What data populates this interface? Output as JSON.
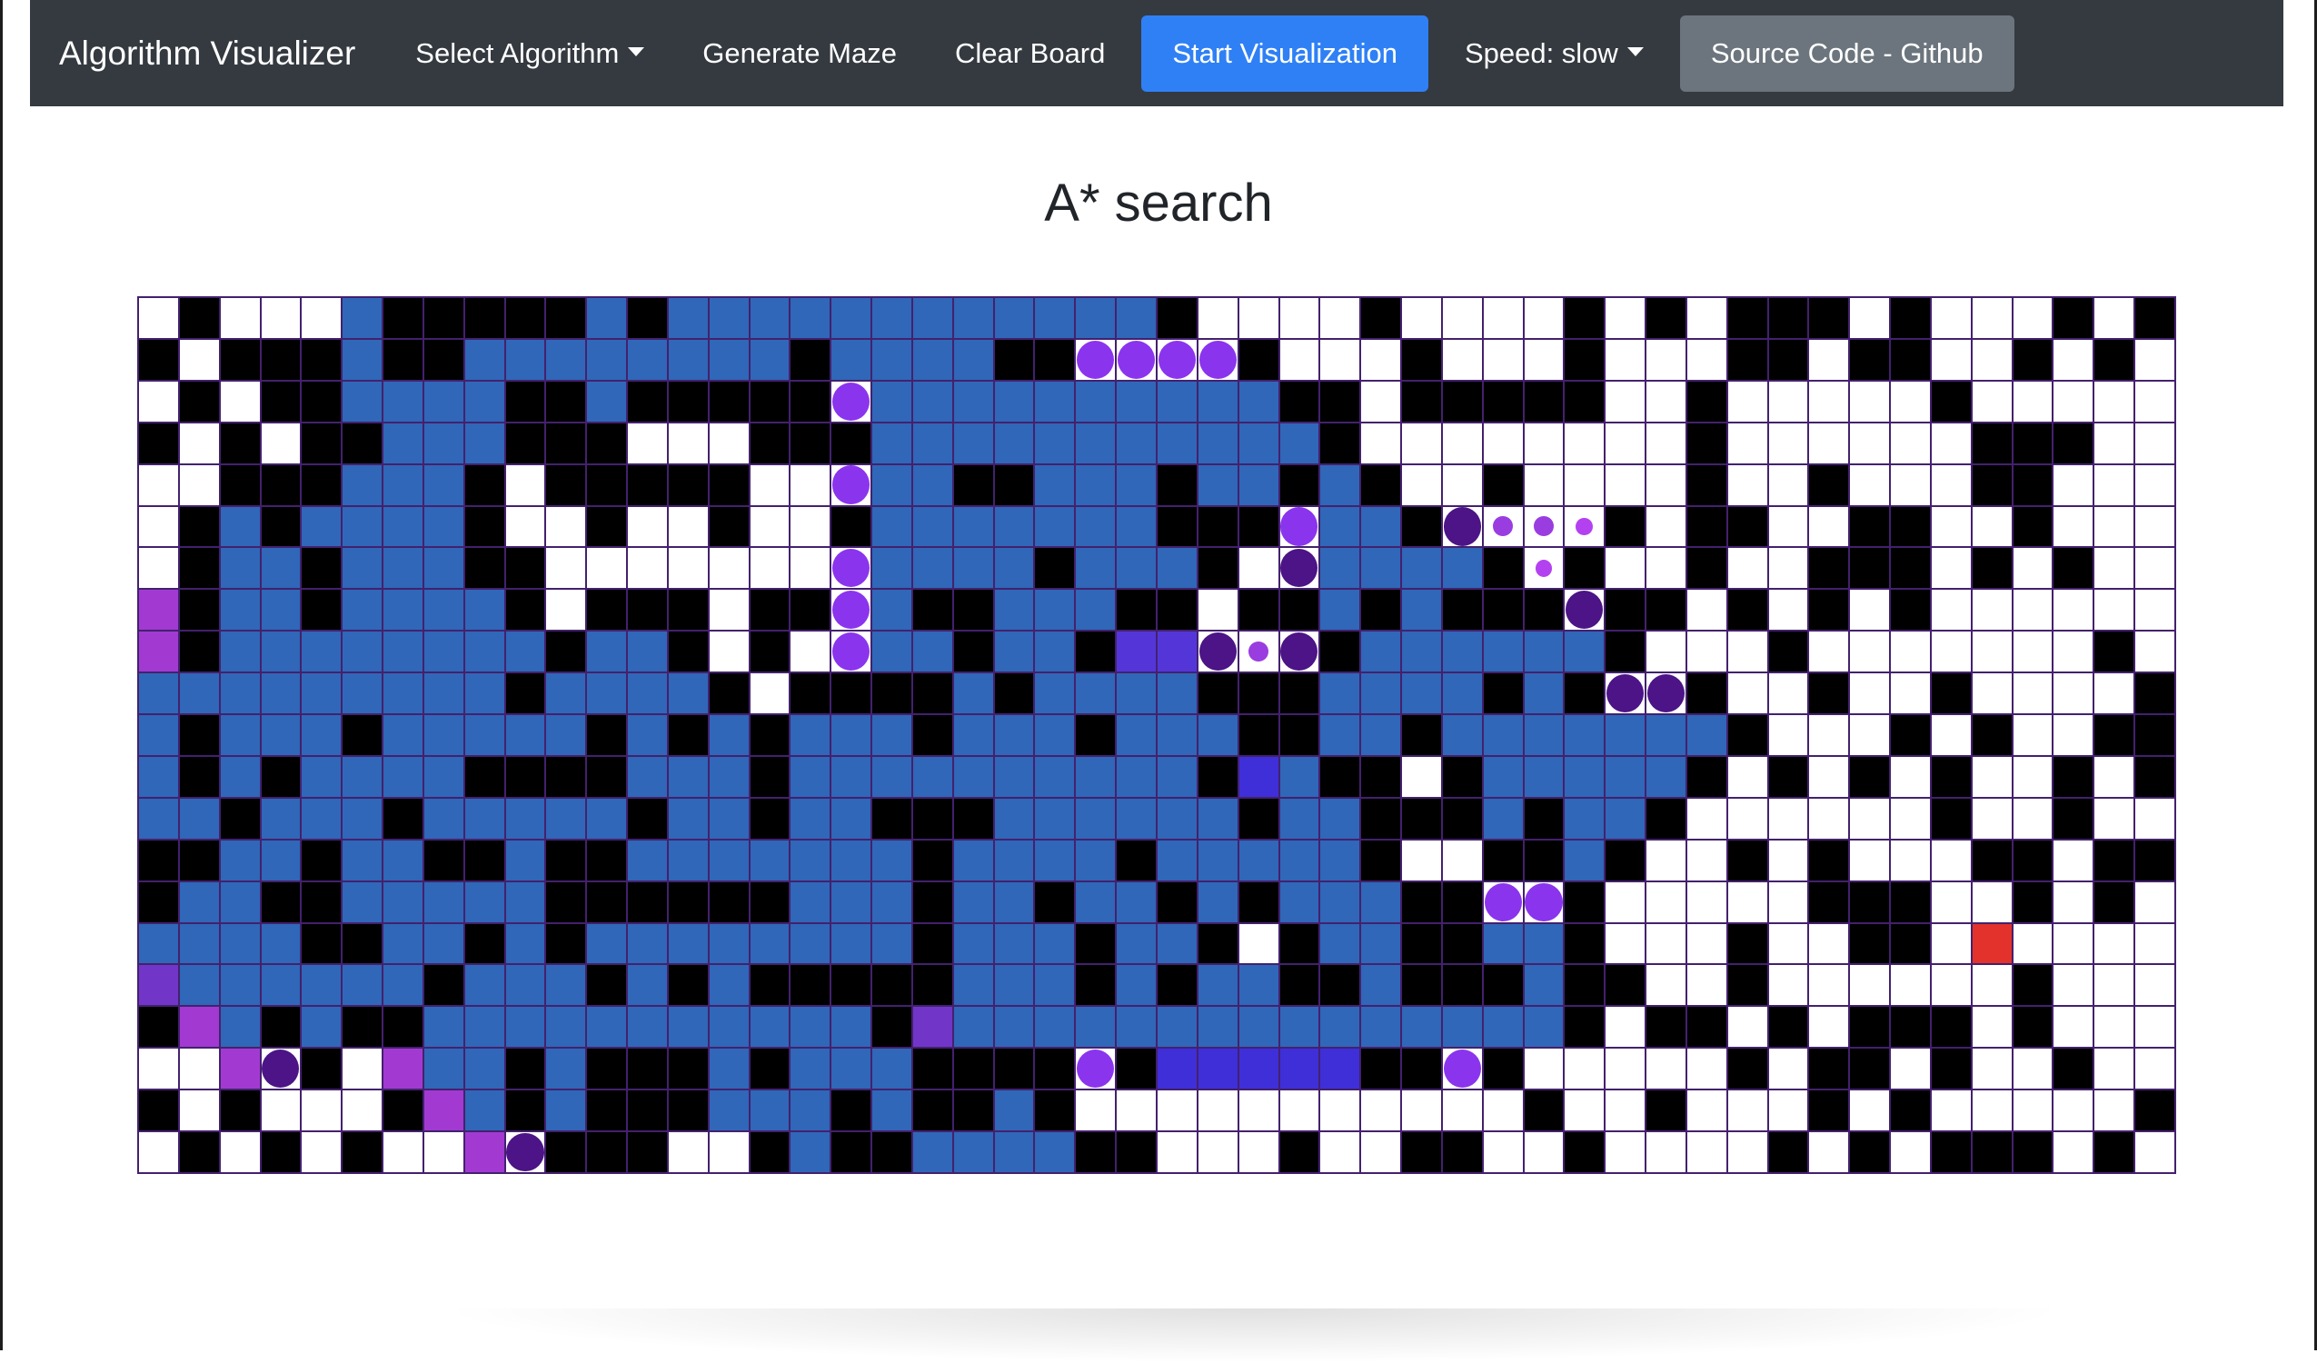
{
  "navbar": {
    "brand": "Algorithm Visualizer",
    "select_algorithm": "Select Algorithm",
    "generate_maze": "Generate Maze",
    "clear_board": "Clear Board",
    "start_visualization": "Start Visualization",
    "speed": "Speed: slow",
    "source_code": "Source Code - Github"
  },
  "page": {
    "title": "A* search"
  },
  "colors": {
    "navbar_bg": "#343a40",
    "primary_button": "#2f80f5",
    "secondary_button": "#6c757d",
    "wall": "#000000",
    "visited": "#3067b8",
    "start_node": "#a23ad2",
    "target_node": "#e3312b",
    "path_node": "#8b34ee",
    "grid_border": "#43216e"
  },
  "grid": {
    "rows": 21,
    "cols": 50,
    "legend": {
      "e": "empty",
      "w": "wall",
      "v": "visited",
      "s": "start-cell",
      "t": "target-cell",
      "f": "frontier-cell",
      "q": "queued-cell",
      "o": "open-cell",
      "pl": "path-dot-large",
      "pd": "path-dot-dark",
      "pm": "path-dot-medium",
      "ps": "path-dot-small"
    },
    "cells": [
      "e,w,e,e,e,v,w,w,w,w,w,v,w,v,v,v,v,v,v,v,v,v,v,v,v,w,e,e,e,e,w,e,e,e,e,w,e,w,e,w,w,w,e,w,e,e,e,w,e,w,w,e",
      "w,e,w,w,w,v,w,w,v,v,v,v,v,v,v,v,w,v,v,v,v,w,w,pl,pl,pl,pl,w,e,e,e,w,e,e,e,w,e,e,e,w,w,e,w,w,e,e,w,e,w,e",
      "e,w,e,w,w,v,v,v,v,w,w,v,w,w,w,w,w,pl,v,v,v,v,v,v,v,v,v,v,w,w,e,w,w,w,w,w,e,e,w,e,e,e,e,e,w,e,e,e,e,e",
      "w,e,w,e,w,w,v,v,v,w,w,w,e,e,e,w,w,w,v,v,v,v,v,v,v,v,v,v,v,w,e,e,e,e,e,e,e,e,w,e,e,e,e,e,e,w,w,w,e,e",
      "e,e,w,w,w,v,v,v,w,e,w,w,w,w,w,e,e,pl,v,v,w,w,v,v,v,w,v,v,w,v,w,e,e,w,e,e,e,e,w,e,e,w,e,e,e,w,w,e,e,e",
      "e,w,v,w,v,v,v,v,w,e,e,w,e,e,w,e,e,w,v,v,v,v,v,v,v,w,w,w,pl,v,v,w,pd,pm,pm,ps,w,e,w,w,e,e,w,w,e,e,w,e,e,e",
      "e,w,v,v,w,v,v,v,w,w,e,e,e,e,e,e,e,pl,v,v,v,v,w,v,v,v,w,e,pd,v,v,v,v,w,ps,w,e,e,w,e,e,w,w,w,e,w,e,w,e,e",
      "s,w,v,v,w,v,v,v,v,w,e,w,w,w,e,w,w,pl,v,w,w,v,v,v,w,w,e,w,w,v,w,v,w,w,w,pd,w,w,e,w,e,w,e,w,e,e,e,e,e,e",
      "s,w,v,v,v,v,v,v,v,v,w,v,v,w,e,w,e,pl,v,v,w,v,v,w,f,f,pd,pm,pd,w,v,v,v,v,v,v,w,e,e,e,w,e,e,e,e,e,e,e,w,e",
      "v,v,v,v,v,v,v,v,v,w,v,v,v,v,w,e,w,w,w,w,v,w,v,v,v,v,w,w,w,v,v,v,v,w,v,w,pd,pd,w,e,e,w,e,e,w,e,e,e,e,w",
      "v,w,v,v,v,w,v,v,v,v,v,w,v,w,v,w,v,v,v,w,v,v,v,w,v,v,v,w,w,v,v,w,v,v,v,v,v,v,v,w,e,e,e,w,e,w,e,e,w,w",
      "v,w,v,w,v,v,v,v,w,w,w,w,v,v,v,w,v,v,v,v,v,v,v,v,v,v,w,o,v,w,w,e,w,v,v,v,v,v,w,e,w,e,w,e,w,e,e,w,e,w",
      "v,v,w,v,v,v,w,v,v,v,v,v,w,v,v,w,v,v,w,w,w,v,v,v,v,v,v,w,v,v,w,w,w,v,w,v,v,w,e,e,e,e,e,e,w,e,e,w,e,e",
      "w,w,v,v,w,v,v,w,w,v,w,w,v,v,v,v,v,v,v,w,v,v,v,v,w,v,v,v,v,v,w,e,e,w,w,v,w,e,e,w,e,w,e,e,e,w,w,e,w,w",
      "w,v,v,w,w,v,v,v,v,v,w,w,w,w,w,w,v,v,v,w,v,v,w,v,v,w,v,w,v,v,v,w,w,pl,pl,w,e,e,e,e,e,w,w,w,e,e,w,e,w,e",
      "v,v,v,v,w,w,v,v,w,v,w,v,v,v,v,v,v,v,v,w,v,v,v,w,v,v,w,e,w,v,v,w,w,v,v,w,e,e,e,w,e,e,w,w,e,t,e,e,e,e",
      "q,v,v,v,v,v,v,w,v,v,v,w,v,w,v,w,w,w,w,w,v,v,v,w,v,w,v,v,w,w,v,w,w,w,v,w,w,e,e,w,e,e,e,e,e,e,w,e,e,e",
      "w,s,v,w,v,w,w,v,v,v,v,v,v,v,v,v,v,v,w,q,v,v,v,v,v,v,v,v,v,v,v,v,v,v,v,w,e,w,w,e,w,e,w,w,w,e,w,e,e,e",
      "e,e,s,pd,w,e,s,v,v,w,v,w,w,w,v,w,v,v,v,w,w,w,w,pl,w,o,o,o,o,o,w,w,pl,w,e,e,e,e,e,w,e,w,w,e,w,e,e,w,e,e",
      "w,e,w,e,e,e,w,s,v,w,v,w,w,w,v,v,v,w,v,w,w,v,w,e,e,e,e,e,e,e,e,e,e,e,w,e,e,w,e,e,e,w,e,w,e,e,e,e,e,w",
      "e,w,e,w,e,w,e,e,s,pd,w,w,w,e,e,w,v,w,w,v,v,v,v,w,w,e,e,e,w,e,e,w,w,e,e,w,e,e,e,e,w,e,w,e,w,w,w,e,w,e"
    ]
  }
}
